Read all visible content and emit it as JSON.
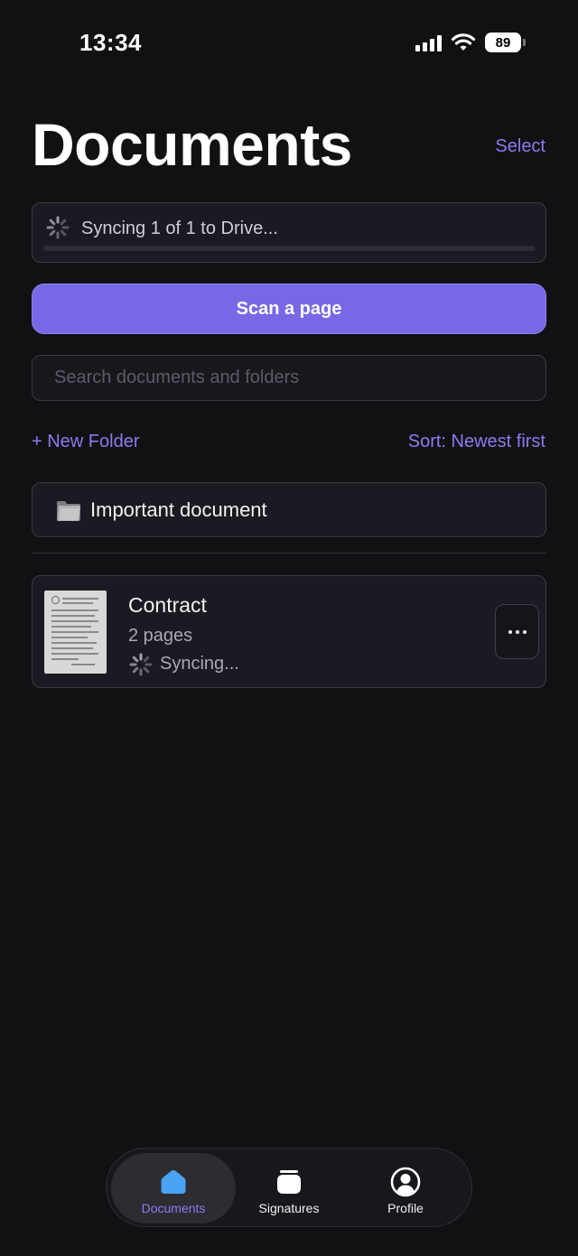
{
  "status_bar": {
    "time": "13:34",
    "battery": "89"
  },
  "header": {
    "title": "Documents",
    "select_label": "Select"
  },
  "sync_banner": {
    "text": "Syncing 1 of 1 to Drive...",
    "progress_fraction": 0.0
  },
  "scan_button": {
    "label": "Scan a page"
  },
  "search": {
    "placeholder": "Search documents and folders",
    "value": ""
  },
  "actions": {
    "new_folder_label": "+ New Folder",
    "sort_label": "Sort: Newest first"
  },
  "folders": [
    {
      "name": "Important document",
      "icon": "folder-icon"
    }
  ],
  "documents": [
    {
      "title": "Contract",
      "pages": "2 pages",
      "status": "Syncing..."
    }
  ],
  "tab_bar": {
    "tabs": [
      {
        "label": "Documents",
        "icon": "home-icon",
        "active": true
      },
      {
        "label": "Signatures",
        "icon": "signatures-icon",
        "active": false
      },
      {
        "label": "Profile",
        "icon": "profile-icon",
        "active": false
      }
    ]
  },
  "colors": {
    "background": "#111113",
    "accent": "#7768e6",
    "link": "#8b7cf0",
    "active_tab_icon": "#4aa3f5"
  }
}
